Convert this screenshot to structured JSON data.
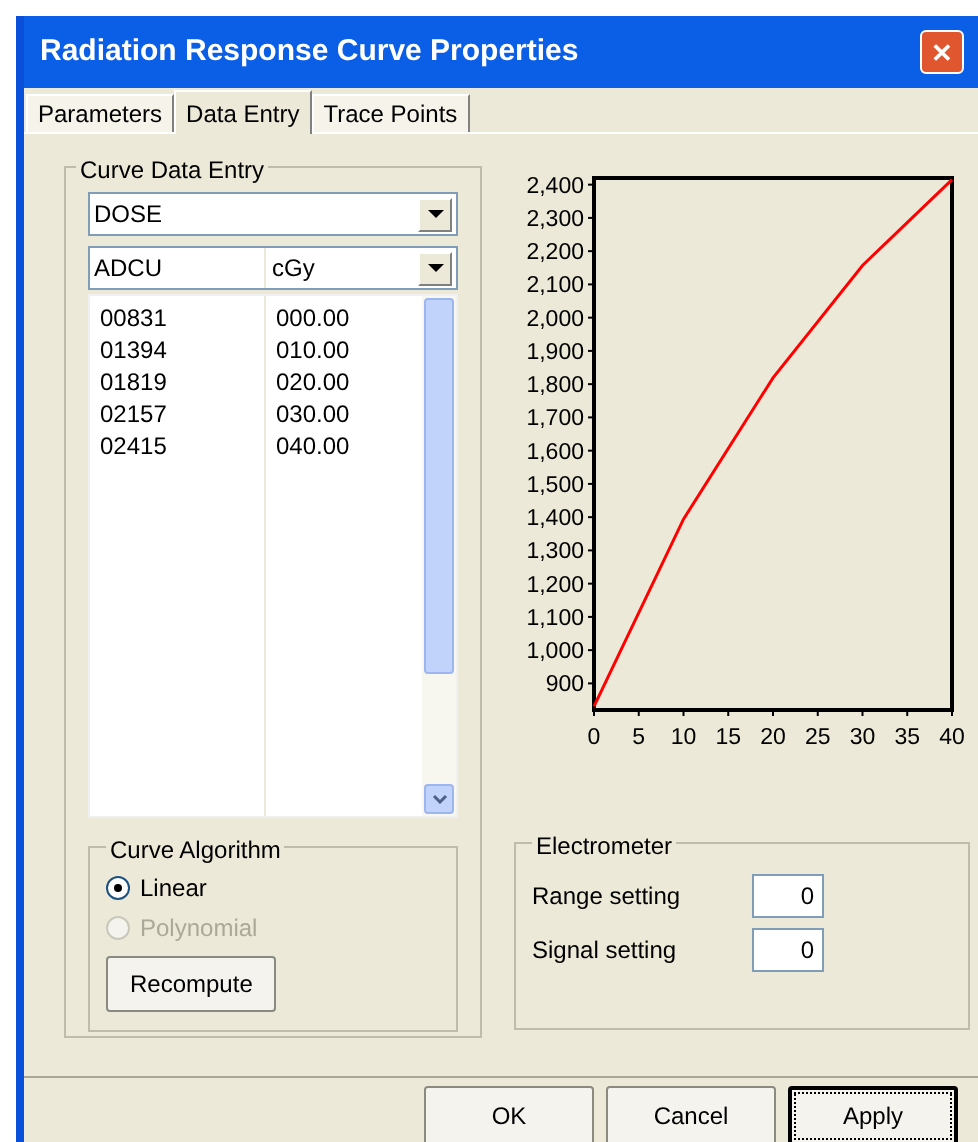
{
  "window": {
    "title": "Radiation Response Curve Properties",
    "close": "✕"
  },
  "tabs": [
    {
      "label": "Parameters",
      "selected": false
    },
    {
      "label": "Data Entry",
      "selected": true
    },
    {
      "label": "Trace Points",
      "selected": false
    }
  ],
  "curve_data_entry": {
    "title": "Curve Data Entry",
    "quantity": "DOSE",
    "columns": [
      "ADCU",
      "cGy"
    ],
    "rows": [
      [
        "00831",
        "000.00"
      ],
      [
        "01394",
        "010.00"
      ],
      [
        "01819",
        "020.00"
      ],
      [
        "02157",
        "030.00"
      ],
      [
        "02415",
        "040.00"
      ]
    ]
  },
  "curve_algorithm": {
    "title": "Curve Algorithm",
    "options": [
      {
        "label": "Linear",
        "selected": true,
        "disabled": false
      },
      {
        "label": "Polynomial",
        "selected": false,
        "disabled": true
      }
    ],
    "button": "Recompute"
  },
  "chart_data": {
    "type": "line",
    "x": [
      0,
      10,
      20,
      30,
      40
    ],
    "series": [
      {
        "color": "#ff0000",
        "values": [
          831,
          1394,
          1819,
          2157,
          2415
        ]
      }
    ],
    "xlim": [
      0,
      40
    ],
    "ylim": [
      820,
      2420
    ],
    "xticks": [
      0,
      5,
      10,
      15,
      20,
      25,
      30,
      35,
      40
    ],
    "yticks": [
      {
        "value": 900,
        "label": "900"
      },
      {
        "value": 1000,
        "label": "1,000"
      },
      {
        "value": 1100,
        "label": "1,100"
      },
      {
        "value": 1200,
        "label": "1,200"
      },
      {
        "value": 1300,
        "label": "1,300"
      },
      {
        "value": 1400,
        "label": "1,400"
      },
      {
        "value": 1500,
        "label": "1,500"
      },
      {
        "value": 1600,
        "label": "1,600"
      },
      {
        "value": 1700,
        "label": "1,700"
      },
      {
        "value": 1800,
        "label": "1,800"
      },
      {
        "value": 1900,
        "label": "1,900"
      },
      {
        "value": 2000,
        "label": "2,000"
      },
      {
        "value": 2100,
        "label": "2,100"
      },
      {
        "value": 2200,
        "label": "2,200"
      },
      {
        "value": 2300,
        "label": "2,300"
      },
      {
        "value": 2400,
        "label": "2,400"
      }
    ]
  },
  "electrometer": {
    "title": "Electrometer",
    "fields": [
      {
        "label": "Range setting",
        "value": "0"
      },
      {
        "label": "Signal setting",
        "value": "0"
      }
    ]
  },
  "buttons": [
    {
      "label": "OK",
      "focused": false
    },
    {
      "label": "Cancel",
      "focused": false
    },
    {
      "label": "Apply",
      "focused": true
    }
  ]
}
